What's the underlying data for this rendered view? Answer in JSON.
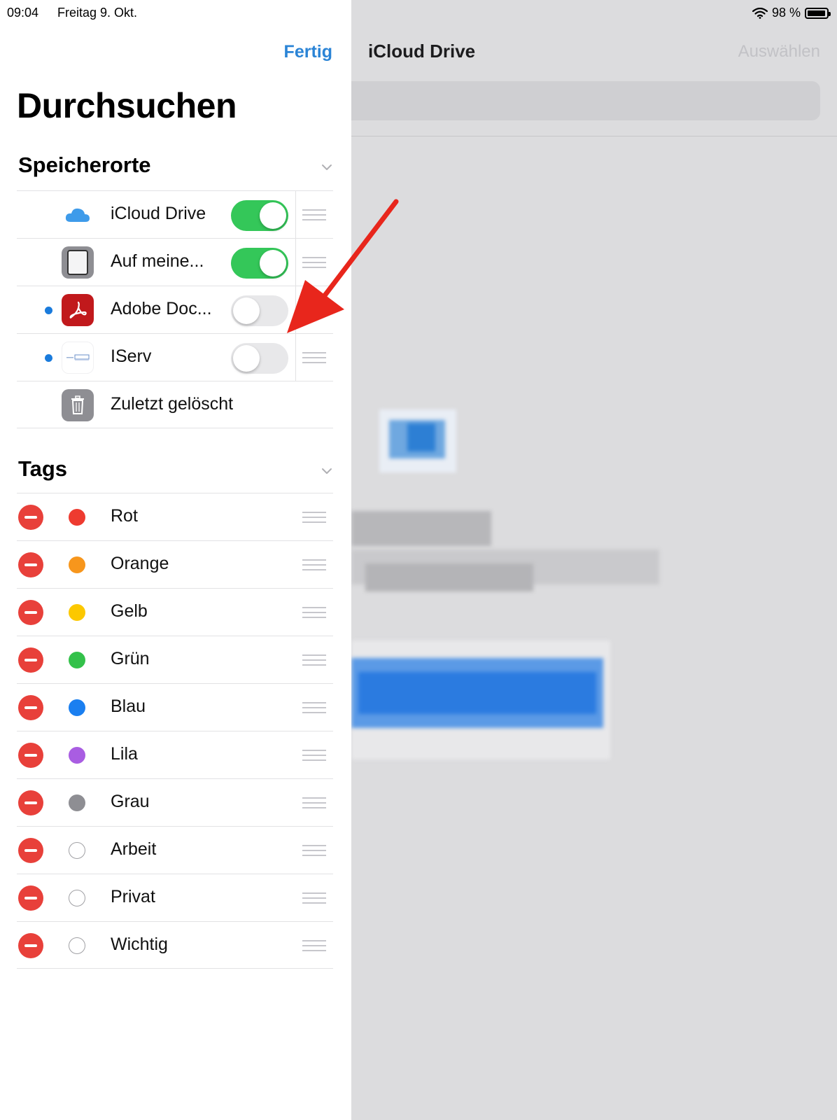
{
  "status_bar": {
    "time": "09:04",
    "date": "Freitag 9. Okt.",
    "battery": "98 %"
  },
  "right_pane": {
    "title": "iCloud Drive",
    "select_label": "Auswählen"
  },
  "left_pane": {
    "done_label": "Fertig",
    "title": "Durchsuchen",
    "locations_header": "Speicherorte",
    "locations": [
      {
        "label": "iCloud Drive",
        "icon": "icloud-icon",
        "toggle_on": true
      },
      {
        "label": "Auf meine...",
        "icon": "ipad-icon",
        "toggle_on": true
      },
      {
        "label": "Adobe Doc...",
        "icon": "adobe-acrobat-icon",
        "toggle_on": false,
        "unread_dot_color": "#1a7bdc"
      },
      {
        "label": "IServ",
        "icon": "iserv-icon",
        "toggle_on": false,
        "unread_dot_color": "#1a7bdc"
      },
      {
        "label": "Zuletzt gelöscht",
        "icon": "trash-icon"
      }
    ],
    "tags_header": "Tags",
    "tags": [
      {
        "label": "Rot",
        "color": "#ee3b30"
      },
      {
        "label": "Orange",
        "color": "#f7961c"
      },
      {
        "label": "Gelb",
        "color": "#fcc800"
      },
      {
        "label": "Grün",
        "color": "#33c14a"
      },
      {
        "label": "Blau",
        "color": "#1a7ff0"
      },
      {
        "label": "Lila",
        "color": "#a95de2"
      },
      {
        "label": "Grau",
        "color": "#8e8e93"
      },
      {
        "label": "Arbeit",
        "color": "none"
      },
      {
        "label": "Privat",
        "color": "none"
      },
      {
        "label": "Wichtig",
        "color": "none"
      }
    ]
  },
  "colors": {
    "accent": "#2b84d6",
    "toggle_on": "#34c759",
    "delete": "#e8403a",
    "annotation_arrow": "#e8261c"
  }
}
